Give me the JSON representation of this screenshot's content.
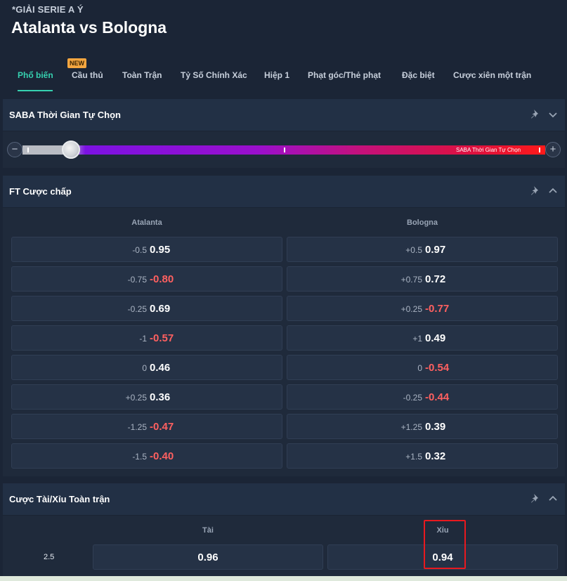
{
  "league": "*GIẢI SERIE A Ý",
  "match_title": "Atalanta vs Bologna",
  "tabs": [
    {
      "label": "Phổ biến"
    },
    {
      "label": "Cầu thủ"
    },
    {
      "label": "Toàn Trận"
    },
    {
      "label": "Tỷ Số Chính Xác"
    },
    {
      "label": "Hiệp 1"
    },
    {
      "label": "Phạt góc/Thẻ phạt"
    },
    {
      "label": "Đặc biệt"
    },
    {
      "label": "Cược xiên một trận"
    }
  ],
  "new_badge": "NEW",
  "saba": {
    "title": "SABA Thời Gian Tự Chọn",
    "slider_label": "SABA Thời Gian Tự Chọn",
    "minus": "−",
    "plus": "+"
  },
  "handicap": {
    "title": "FT Cược chấp",
    "home": "Atalanta",
    "away": "Bologna",
    "rows": [
      {
        "home_line": "-0.5",
        "home_price": "0.95",
        "away_line": "+0.5",
        "away_price": "0.97"
      },
      {
        "home_line": "-0.75",
        "home_price": "-0.80",
        "away_line": "+0.75",
        "away_price": "0.72"
      },
      {
        "home_line": "-0.25",
        "home_price": "0.69",
        "away_line": "+0.25",
        "away_price": "-0.77"
      },
      {
        "home_line": "-1",
        "home_price": "-0.57",
        "away_line": "+1",
        "away_price": "0.49"
      },
      {
        "home_line": "0",
        "home_price": "0.46",
        "away_line": "0",
        "away_price": "-0.54"
      },
      {
        "home_line": "+0.25",
        "home_price": "0.36",
        "away_line": "-0.25",
        "away_price": "-0.44"
      },
      {
        "home_line": "-1.25",
        "home_price": "-0.47",
        "away_line": "+1.25",
        "away_price": "0.39"
      },
      {
        "home_line": "-1.5",
        "home_price": "-0.40",
        "away_line": "+1.5",
        "away_price": "0.32"
      }
    ]
  },
  "over_under": {
    "title": "Cược Tài/Xỉu Toàn trận",
    "over": "Tài",
    "under": "Xỉu",
    "rows": [
      {
        "line": "2.5",
        "over_price": "0.96",
        "under_price": "0.94"
      }
    ]
  },
  "colors": {
    "accent": "#36d1b0",
    "negative": "#ff6060",
    "highlight": "#e8191f"
  }
}
